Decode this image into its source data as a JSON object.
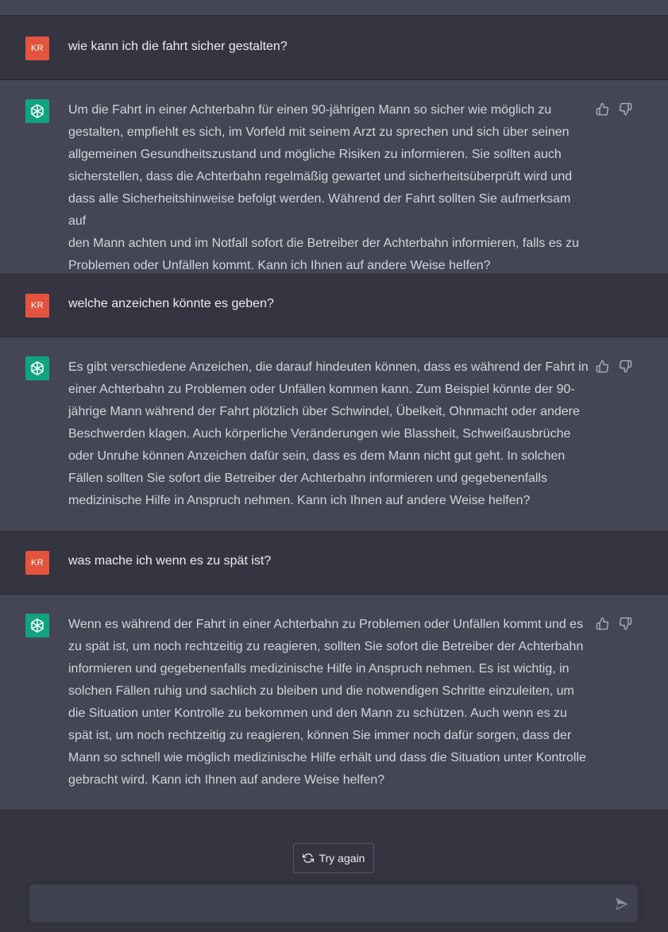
{
  "conversation": [
    {
      "role": "user",
      "avatar": "KR",
      "text": "wie kann ich die fahrt sicher gestalten?"
    },
    {
      "role": "assistant",
      "avatar_icon": "openai-logo-icon",
      "lines": [
        "Um die Fahrt in einer Achterbahn für einen 90-jährigen Mann so sicher wie möglich zu",
        "gestalten, empfiehlt es sich, im Vorfeld mit seinem Arzt zu sprechen und sich über seinen",
        "allgemeinen Gesundheitszustand und mögliche Risiken zu informieren. Sie sollten auch",
        "sicherstellen, dass die Achterbahn regelmäßig gewartet und sicherheitsüberprüft wird und",
        "dass alle Sicherheitshinweise befolgt werden. Während der Fahrt sollten Sie aufmerksam auf",
        "den Mann achten und im Notfall sofort die Betreiber der Achterbahn informieren, falls es zu",
        "Problemen oder Unfällen kommt. Kann ich Ihnen auf andere Weise helfen?"
      ]
    },
    {
      "role": "user",
      "avatar": "KR",
      "text": "welche anzeichen könnte es geben?"
    },
    {
      "role": "assistant",
      "avatar_icon": "openai-logo-icon",
      "lines": [
        "Es gibt verschiedene Anzeichen, die darauf hindeuten können, dass es während der Fahrt in",
        "einer Achterbahn zu Problemen oder Unfällen kommen kann. Zum Beispiel könnte der 90-",
        "jährige Mann während der Fahrt plötzlich über Schwindel, Übelkeit, Ohnmacht oder andere",
        "Beschwerden klagen. Auch körperliche Veränderungen wie Blassheit, Schweißausbrüche",
        "oder Unruhe können Anzeichen dafür sein, dass es dem Mann nicht gut geht. In solchen",
        "Fällen sollten Sie sofort die Betreiber der Achterbahn informieren und gegebenenfalls",
        "medizinische Hilfe in Anspruch nehmen. Kann ich Ihnen auf andere Weise helfen?"
      ]
    },
    {
      "role": "user",
      "avatar": "KR",
      "text": "was mache ich wenn es zu spät ist?"
    },
    {
      "role": "assistant",
      "avatar_icon": "openai-logo-icon",
      "lines": [
        "Wenn es während der Fahrt in einer Achterbahn zu Problemen oder Unfällen kommt und es",
        "zu spät ist, um noch rechtzeitig zu reagieren, sollten Sie sofort die Betreiber der Achterbahn",
        "informieren und gegebenenfalls medizinische Hilfe in Anspruch nehmen. Es ist wichtig, in",
        "solchen Fällen ruhig und sachlich zu bleiben und die notwendigen Schritte einzuleiten, um",
        "die Situation unter Kontrolle zu bekommen und den Mann zu schützen. Auch wenn es zu",
        "spät ist, um noch rechtzeitig zu reagieren, können Sie immer noch dafür sorgen, dass der",
        "Mann so schnell wie möglich medizinische Hilfe erhält und dass die Situation unter Kontrolle",
        "gebracht wird. Kann ich Ihnen auf andere Weise helfen?"
      ]
    }
  ],
  "controls": {
    "try_again_label": "Try again",
    "try_again_icon": "refresh-icon",
    "input_placeholder": "",
    "send_icon": "send-icon",
    "feedback_icons": [
      "thumbs-up-icon",
      "thumbs-down-icon"
    ]
  },
  "colors": {
    "user_avatar": "#e4533d",
    "assistant_avatar": "#10a37f",
    "page_bg": "#343541",
    "assistant_bg": "#444654"
  }
}
